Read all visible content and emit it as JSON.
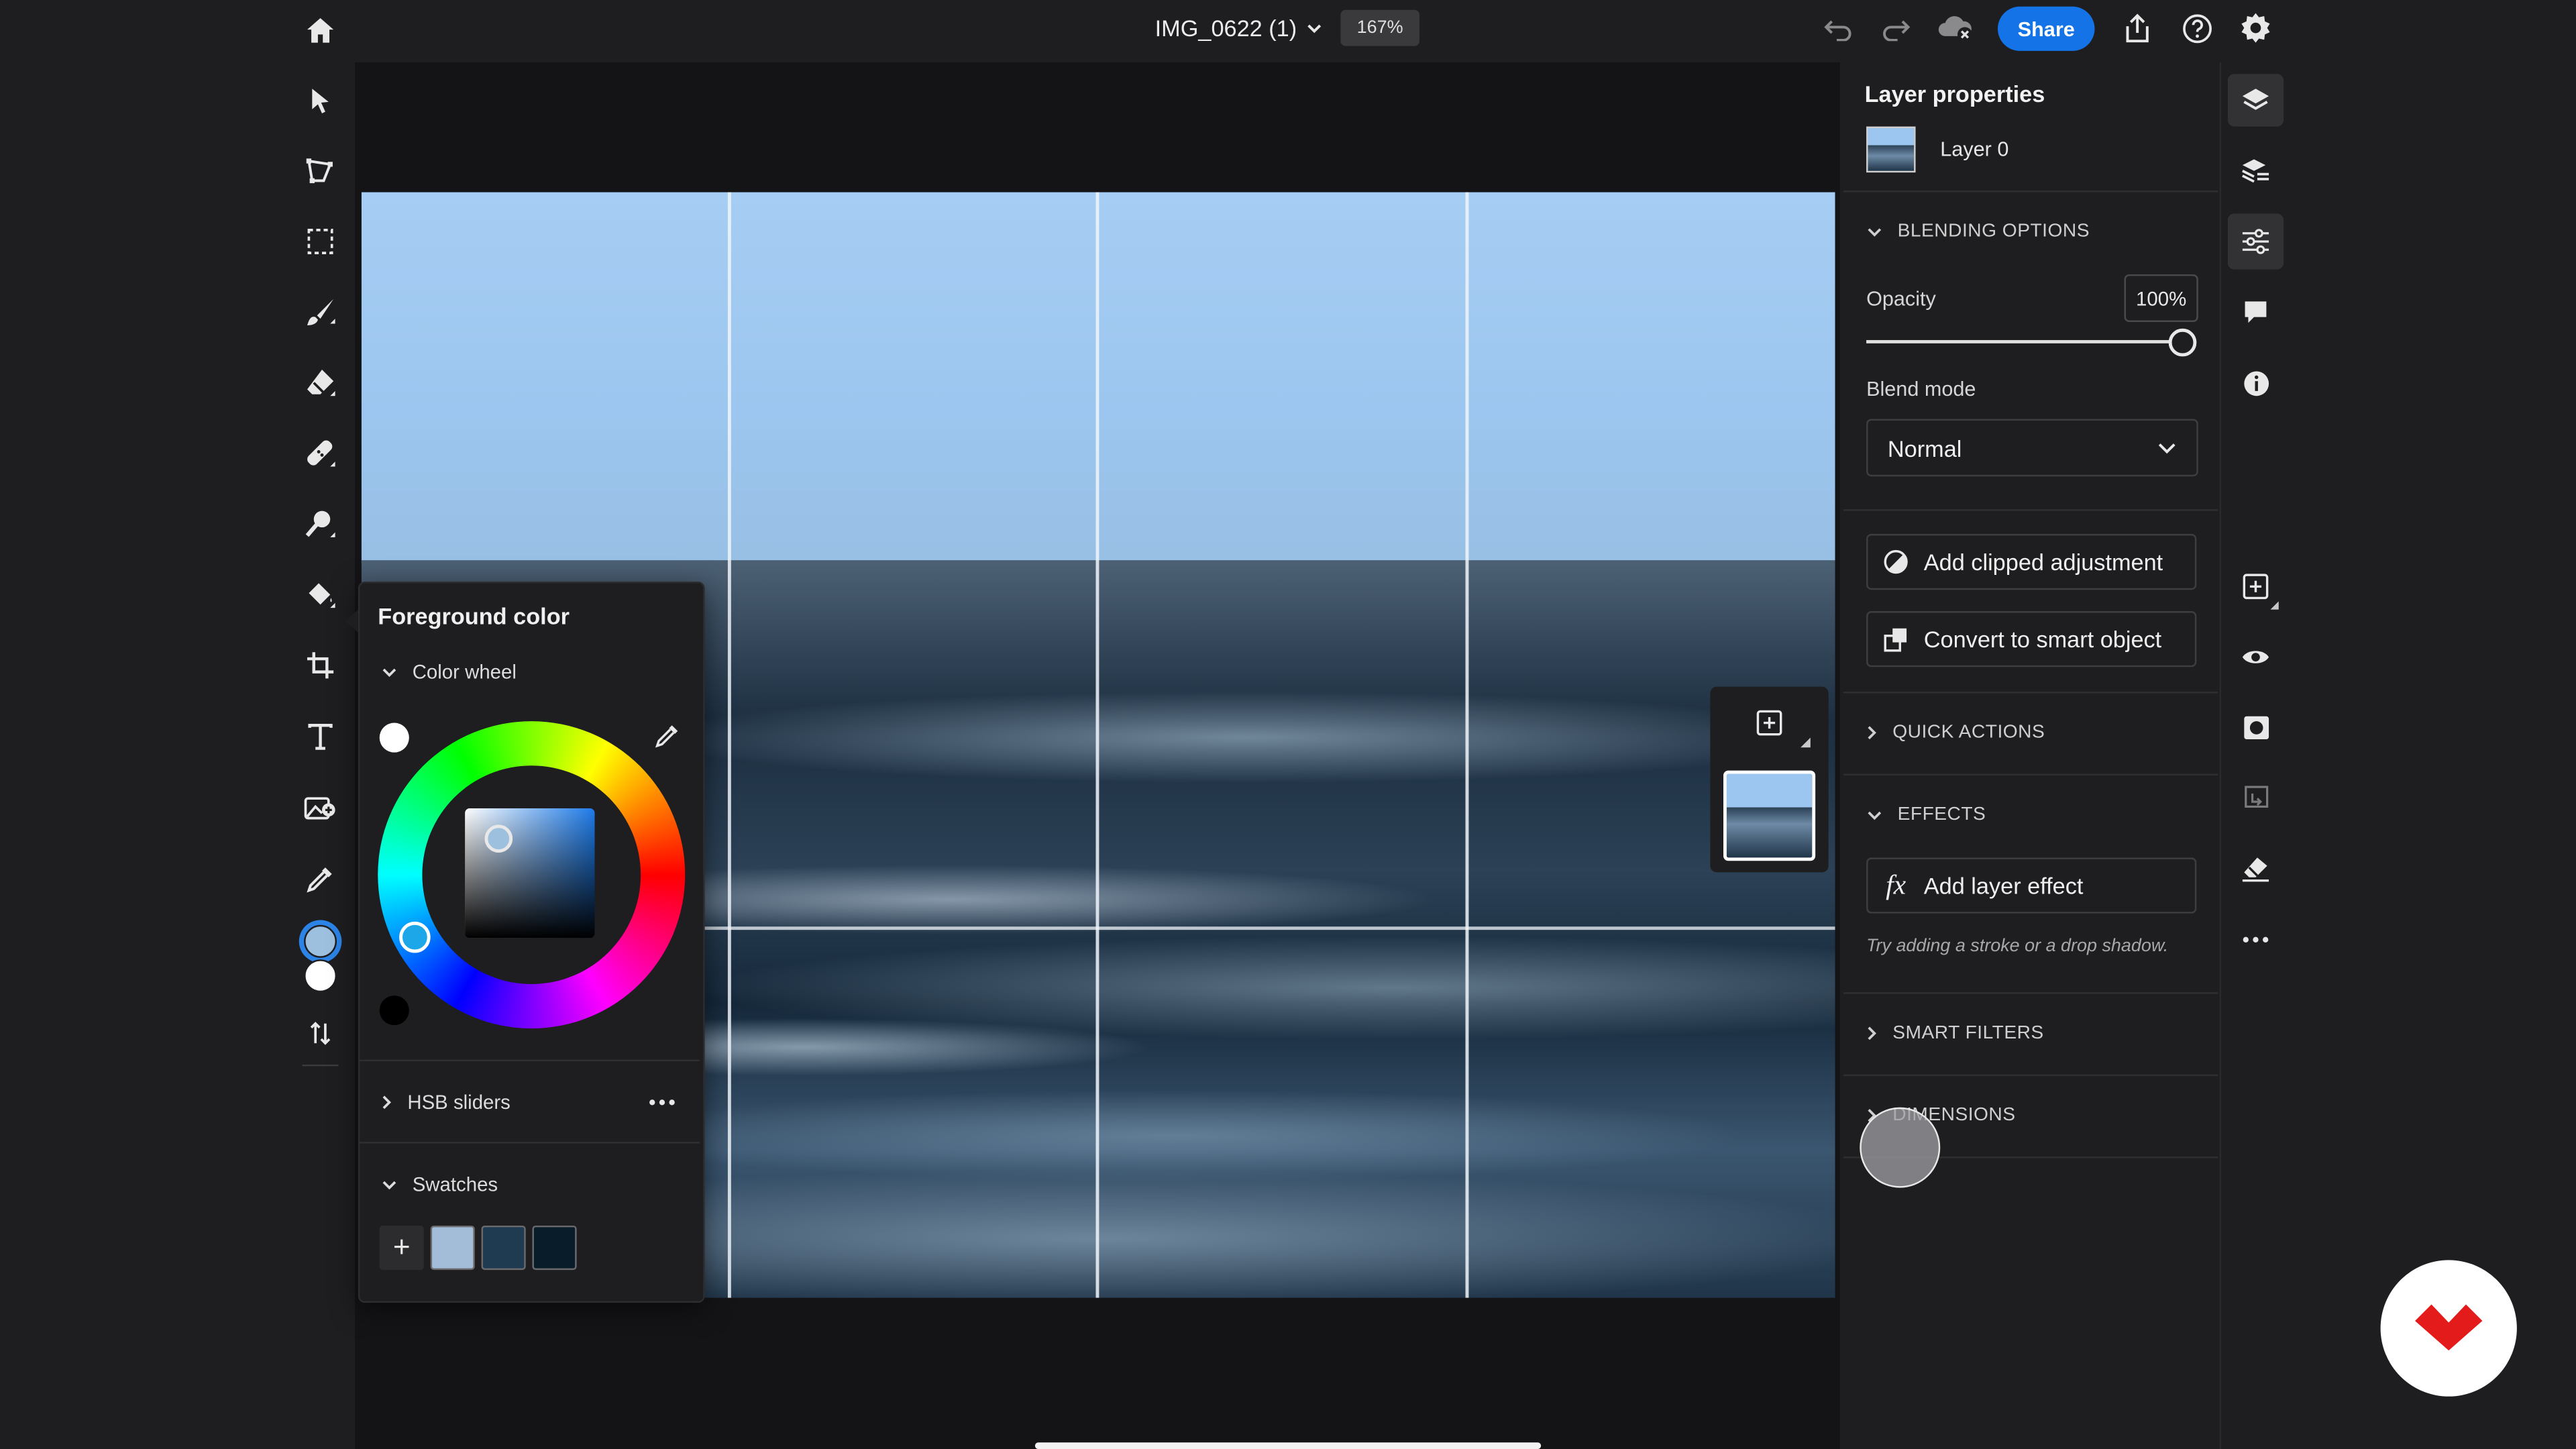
{
  "document": {
    "title": "IMG_0622 (1)",
    "zoom": "167%"
  },
  "topbar": {
    "share_label": "Share"
  },
  "color_popover": {
    "title": "Foreground color",
    "color_wheel_label": "Color wheel",
    "hsb_sliders_label": "HSB sliders",
    "swatches_label": "Swatches",
    "add_swatch": "+",
    "swatches": [
      "#a3bdd8",
      "#1f3b52",
      "#091c29"
    ],
    "hue_color": "#1e7be8"
  },
  "layer_panel": {
    "title": "Layer properties",
    "layer_name": "Layer 0",
    "blending_options": "BLENDING OPTIONS",
    "opacity_label": "Opacity",
    "opacity_value": "100%",
    "opacity_fraction": 1.0,
    "blend_mode_label": "Blend mode",
    "blend_mode_value": "Normal",
    "add_clipped_adjustment": "Add clipped adjustment",
    "convert_to_smart_object": "Convert to smart object",
    "quick_actions": "QUICK ACTIONS",
    "effects": "EFFECTS",
    "add_layer_effect": "Add layer effect",
    "effect_hint": "Try adding a stroke or a drop shadow.",
    "smart_filters": "SMART FILTERS",
    "dimensions": "DIMENSIONS"
  },
  "tools": [
    "select-tool",
    "quick-selection-tool",
    "marquee-tool",
    "brush-tool",
    "eraser-tool",
    "healing-brush-tool",
    "clone-stamp-tool",
    "paint-bucket-tool",
    "crop-tool",
    "type-tool",
    "place-image-tool",
    "eyedropper-tool"
  ],
  "colors": {
    "accent": "#1473e6",
    "foreground": "#9ec0df",
    "background": "#ffffff",
    "brand": "#e31b1b"
  }
}
